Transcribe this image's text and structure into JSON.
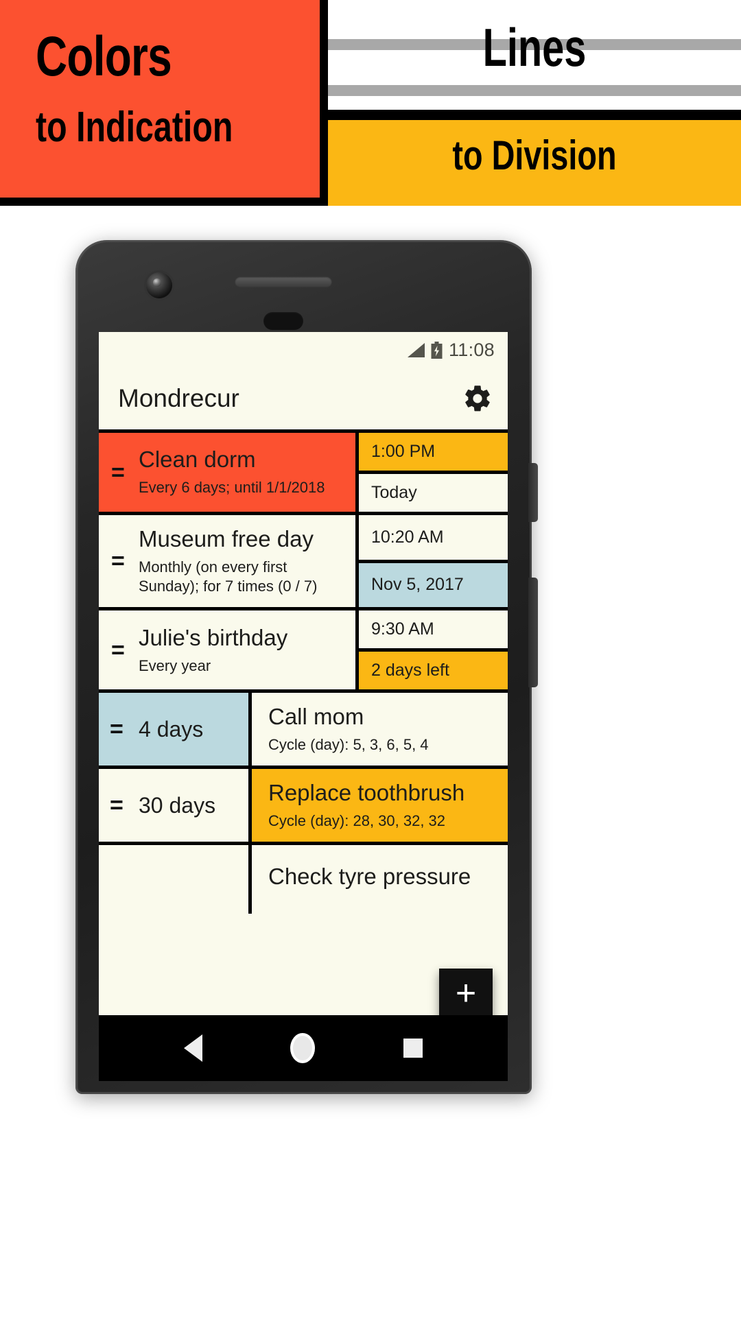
{
  "promo": {
    "left_line1": "Colors",
    "left_line2": "to Indication",
    "right_line1": "Lines",
    "right_line2": "to Division",
    "colors": {
      "orange": "#FC5130",
      "yellow": "#FBB714",
      "gray_stripe": "#A8A8A8",
      "black": "#000000",
      "white": "#FFFFFF"
    }
  },
  "status_bar": {
    "time": "11:08",
    "signal_icon": "signal-triangle-icon",
    "battery_icon": "battery-charging-icon"
  },
  "app_bar": {
    "title": "Mondrecur",
    "settings_icon": "gear-icon"
  },
  "list": {
    "drag_handle_glyph": "=",
    "items": [
      {
        "layout": "title-left",
        "title": "Clean dorm",
        "subtitle": "Every 6 days; until 1/1/2018",
        "title_bg": "#FC5130",
        "time": "1:00 PM",
        "time_bg": "#FBB714",
        "date": "Today",
        "date_bg": "#FAFAEC"
      },
      {
        "layout": "title-left",
        "title": "Museum free day",
        "subtitle": "Monthly (on every first Sunday); for 7 times (0 / 7)",
        "title_bg": "#FAFAEC",
        "time": "10:20 AM",
        "time_bg": "#FAFAEC",
        "date": "Nov 5, 2017",
        "date_bg": "#BBD9DF"
      },
      {
        "layout": "title-left",
        "title": "Julie's birthday",
        "subtitle": "Every year",
        "title_bg": "#FAFAEC",
        "time": "9:30 AM",
        "time_bg": "#FAFAEC",
        "date": "2 days left",
        "date_bg": "#FBB714"
      },
      {
        "layout": "interval-left",
        "interval": "4 days",
        "interval_bg": "#BBD9DF",
        "title": "Call mom",
        "subtitle": "Cycle (day): 5, 3, 6, 5, 4",
        "title_bg": "#FAFAEC"
      },
      {
        "layout": "interval-left",
        "interval": "30 days",
        "interval_bg": "#FAFAEC",
        "title": "Replace toothbrush",
        "subtitle": "Cycle (day): 28, 30, 32, 32",
        "title_bg": "#FBB714"
      },
      {
        "layout": "interval-left",
        "interval": "",
        "interval_bg": "#FAFAEC",
        "title": "Check tyre pressure",
        "subtitle": "",
        "title_bg": "#FAFAEC"
      }
    ]
  },
  "fab": {
    "label": "+",
    "icon": "plus-icon"
  },
  "nav_bar": {
    "back_icon": "back-triangle-icon",
    "home_icon": "home-circle-icon",
    "recents_icon": "recents-square-icon"
  }
}
